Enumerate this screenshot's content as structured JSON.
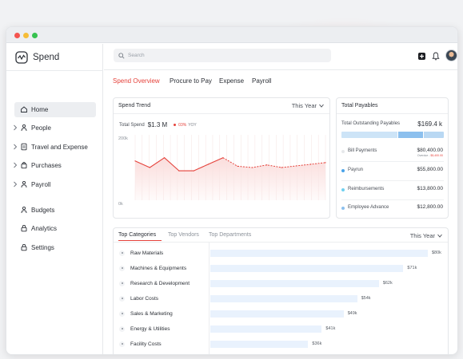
{
  "app": {
    "name": "Spend"
  },
  "search": {
    "placeholder": "Search"
  },
  "sidebar": {
    "items": [
      {
        "label": "Home",
        "icon": "home-icon",
        "active": true,
        "expandable": false
      },
      {
        "label": "People",
        "icon": "person-icon",
        "active": false,
        "expandable": true
      },
      {
        "label": "Travel and Expense",
        "icon": "document-icon",
        "active": false,
        "expandable": true
      },
      {
        "label": "Purchases",
        "icon": "bag-icon",
        "active": false,
        "expandable": true
      },
      {
        "label": "Payroll",
        "icon": "person-icon",
        "active": false,
        "expandable": true
      },
      {
        "label": "Budgets",
        "icon": "person-icon",
        "active": false,
        "expandable": false
      },
      {
        "label": "Analytics",
        "icon": "lock-icon",
        "active": false,
        "expandable": false
      },
      {
        "label": "Settings",
        "icon": "lock-icon",
        "active": false,
        "expandable": false
      }
    ]
  },
  "tabs": [
    "Spend Overview",
    "Procure to Pay",
    "Expense",
    "Payroll"
  ],
  "active_tab": 0,
  "spend_trend": {
    "title": "Spend Trend",
    "period": "This Year",
    "total_label": "Total Spend",
    "total_value": "$1.3 M",
    "change": "03%",
    "change_suffix": "YOY"
  },
  "payables": {
    "title": "Total Payables",
    "total_label": "Total Outstanding Payables",
    "total_value": "$169.4 k",
    "stack": [
      {
        "color": "#cde4f7",
        "share": 0.55
      },
      {
        "color": "#8cc0ee",
        "share": 0.25
      },
      {
        "color": "#b9d8f3",
        "share": 0.2
      }
    ],
    "rows": [
      {
        "label": "Bill Payments",
        "value": "$80,400.00",
        "dot": "#e6e8eb",
        "sub_label": "Overdue - ",
        "sub_value": "$5,400.00"
      },
      {
        "label": "Payrun",
        "value": "$55,800.00",
        "dot": "#4aa3e8"
      },
      {
        "label": "Reimbursements",
        "value": "$13,800.00",
        "dot": "#6fd0f0"
      },
      {
        "label": "Employee Advance",
        "value": "$12,800.00",
        "dot": "#8cc0ee"
      }
    ]
  },
  "categories": {
    "tabs": [
      "Top Categories",
      "Top Vendors",
      "Top Departments"
    ],
    "period": "This Year"
  },
  "chart_data": [
    {
      "type": "line",
      "title": "Spend Trend",
      "y_tick_labels": [
        "200k",
        "0k"
      ],
      "ylim": [
        0,
        200
      ],
      "grid": false,
      "series": [
        {
          "values": [
            120,
            100,
            130,
            90,
            90,
            110,
            130,
            104,
            100,
            108,
            100,
            105,
            110,
            115
          ],
          "style": "solid-then-dashed"
        }
      ],
      "solid_until_index": 6,
      "color": "#e5423b"
    },
    {
      "type": "bar",
      "orientation": "horizontal",
      "categories": [
        "Raw Materials",
        "Machines & Equipments",
        "Research & Development",
        "Labor Costs",
        "Sales & Marketing",
        "Energy & Utilities",
        "Facility Costs"
      ],
      "values": [
        80,
        71,
        62,
        54,
        49,
        41,
        36
      ],
      "labels": [
        "$80k",
        "$71k",
        "$62k",
        "$54k",
        "$49k",
        "$41k",
        "$36k"
      ],
      "xlim": [
        0,
        80
      ],
      "color": "#e9f2fd"
    }
  ]
}
